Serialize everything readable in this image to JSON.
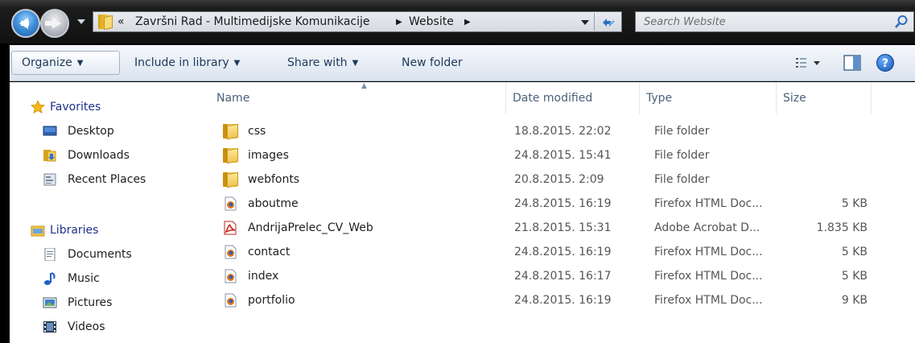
{
  "address_bar": {
    "overflow": "«",
    "breadcrumbs": [
      "Završni Rad - Multimedijske Komunikacije",
      "Website"
    ],
    "separator": "▶"
  },
  "search": {
    "placeholder": "Search Website"
  },
  "toolbar": {
    "organize": "Organize",
    "include_in_library": "Include in library",
    "share_with": "Share with",
    "new_folder": "New folder",
    "help": "?"
  },
  "nav": {
    "favorites": {
      "label": "Favorites",
      "items": [
        {
          "label": "Desktop",
          "icon": "desktop-icon"
        },
        {
          "label": "Downloads",
          "icon": "downloads-icon"
        },
        {
          "label": "Recent Places",
          "icon": "recent-places-icon"
        }
      ]
    },
    "libraries": {
      "label": "Libraries",
      "items": [
        {
          "label": "Documents",
          "icon": "documents-icon"
        },
        {
          "label": "Music",
          "icon": "music-icon"
        },
        {
          "label": "Pictures",
          "icon": "pictures-icon"
        },
        {
          "label": "Videos",
          "icon": "videos-icon"
        }
      ]
    }
  },
  "columns": {
    "name": "Name",
    "date": "Date modified",
    "type": "Type",
    "size": "Size"
  },
  "files": [
    {
      "name": "css",
      "date": "18.8.2015. 22:02",
      "type": "File folder",
      "size": "",
      "icon": "folder-icon"
    },
    {
      "name": "images",
      "date": "24.8.2015. 15:41",
      "type": "File folder",
      "size": "",
      "icon": "folder-icon"
    },
    {
      "name": "webfonts",
      "date": "20.8.2015. 2:09",
      "type": "File folder",
      "size": "",
      "icon": "folder-icon"
    },
    {
      "name": "aboutme",
      "date": "24.8.2015. 16:19",
      "type": "Firefox HTML Doc...",
      "size": "5 KB",
      "icon": "firefox-html-icon"
    },
    {
      "name": "AndrijaPrelec_CV_Web",
      "date": "21.8.2015. 15:31",
      "type": "Adobe Acrobat D...",
      "size": "1.835 KB",
      "icon": "pdf-icon"
    },
    {
      "name": "contact",
      "date": "24.8.2015. 16:19",
      "type": "Firefox HTML Doc...",
      "size": "5 KB",
      "icon": "firefox-html-icon"
    },
    {
      "name": "index",
      "date": "24.8.2015. 16:17",
      "type": "Firefox HTML Doc...",
      "size": "5 KB",
      "icon": "firefox-html-icon"
    },
    {
      "name": "portfolio",
      "date": "24.8.2015. 16:19",
      "type": "Firefox HTML Doc...",
      "size": "9 KB",
      "icon": "firefox-html-icon"
    }
  ],
  "colors": {
    "accent": "#2c6fc2",
    "nav_group_text": "#1e3287",
    "column_header_text": "#4c607a",
    "folder": "#efc64c"
  }
}
